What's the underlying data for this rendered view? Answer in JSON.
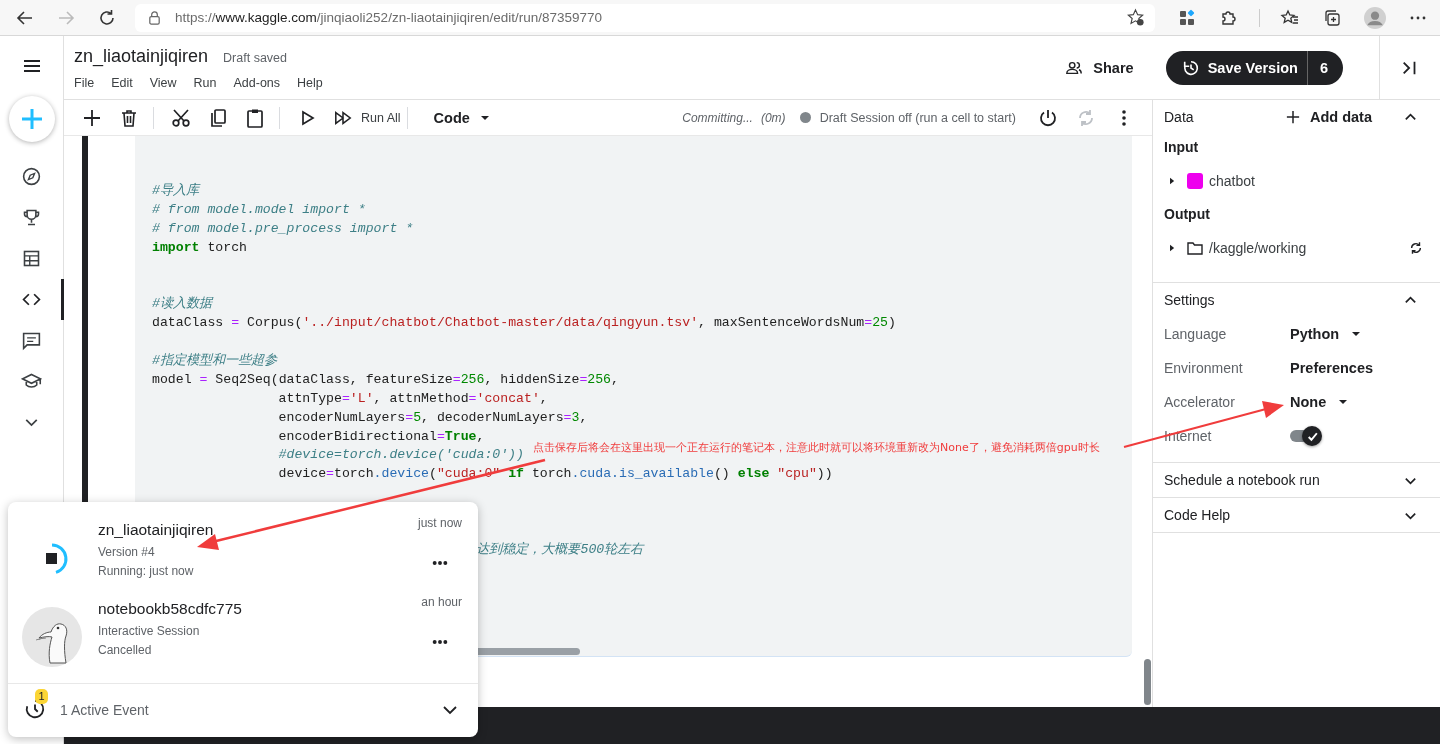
{
  "browser": {
    "url_prefix": "https://",
    "url_host": "www.kaggle.com",
    "url_path": "/jinqiaoli252/zn-liaotainjiqiren/edit/run/87359770",
    "forward_disabled": true
  },
  "rail": {
    "items": [
      {
        "kind": "compass",
        "selected": false
      },
      {
        "kind": "trophy",
        "selected": false
      },
      {
        "kind": "table",
        "selected": false
      },
      {
        "kind": "code",
        "selected": true
      },
      {
        "kind": "comment",
        "selected": false
      },
      {
        "kind": "cap",
        "selected": false
      },
      {
        "kind": "more",
        "selected": false
      }
    ]
  },
  "notebook": {
    "title": "zn_liaotainjiqiren",
    "status": "Draft saved",
    "menu": [
      "File",
      "Edit",
      "View",
      "Run",
      "Add-ons",
      "Help"
    ]
  },
  "header_buttons": {
    "share": "Share",
    "save_version": "Save Version",
    "version_count": "6"
  },
  "toolbar": {
    "run_all": "Run All",
    "cell_type": "Code",
    "commit_status": "Committing...",
    "commit_time": "(0m)",
    "session_status": "Draft Session off (run a cell to start)"
  },
  "code_lines": [
    {
      "kind": "code",
      "tokens": [
        {
          "comment": "#导入库"
        }
      ]
    },
    {
      "kind": "code",
      "tokens": [
        {
          "comment": "# from model.model import *"
        }
      ]
    },
    {
      "kind": "code",
      "tokens": [
        {
          "comment": "# from model.pre_process import *"
        }
      ]
    },
    {
      "kind": "code",
      "tokens": [
        {
          "keyword": "import"
        },
        {
          "text": " torch"
        }
      ]
    },
    {
      "kind": "blank"
    },
    {
      "kind": "blank"
    },
    {
      "kind": "code",
      "tokens": [
        {
          "comment": "#读入数据"
        }
      ]
    },
    {
      "kind": "code",
      "tokens": [
        {
          "text": "dataClass "
        },
        {
          "operator": "="
        },
        {
          "text": " Corpus("
        },
        {
          "string": "'../input/chatbot/Chatbot-master/data/qingyun.tsv'"
        },
        {
          "text": ", maxSentenceWordsNum"
        },
        {
          "operator": "="
        },
        {
          "number": "25"
        },
        {
          "text": ")"
        }
      ]
    },
    {
      "kind": "blank"
    },
    {
      "kind": "code",
      "tokens": [
        {
          "comment": "#指定模型和一些超参"
        }
      ]
    },
    {
      "kind": "code",
      "tokens": [
        {
          "text": "model "
        },
        {
          "operator": "="
        },
        {
          "text": " Seq2Seq(dataClass, featureSize"
        },
        {
          "operator": "="
        },
        {
          "number": "256"
        },
        {
          "text": ", hiddenSize"
        },
        {
          "operator": "="
        },
        {
          "number": "256"
        },
        {
          "text": ","
        }
      ]
    },
    {
      "kind": "code",
      "tokens": [
        {
          "text": "                attnType"
        },
        {
          "operator": "="
        },
        {
          "string": "'L'"
        },
        {
          "text": ", attnMethod"
        },
        {
          "operator": "="
        },
        {
          "string": "'concat'"
        },
        {
          "text": ","
        }
      ]
    },
    {
      "kind": "code",
      "tokens": [
        {
          "text": "                encoderNumLayers"
        },
        {
          "operator": "="
        },
        {
          "number": "5"
        },
        {
          "text": ", decoderNumLayers"
        },
        {
          "operator": "="
        },
        {
          "number": "3"
        },
        {
          "text": ","
        }
      ]
    },
    {
      "kind": "code",
      "tokens": [
        {
          "text": "                encoderBidirectional"
        },
        {
          "operator": "="
        },
        {
          "keyword": "True"
        },
        {
          "text": ","
        }
      ]
    },
    {
      "kind": "code",
      "tokens": [
        {
          "comment": "                #device=torch.device('cuda:0'))"
        }
      ]
    },
    {
      "kind": "code",
      "tokens": [
        {
          "text": "                device"
        },
        {
          "operator": "="
        },
        {
          "text": "torch"
        },
        {
          "attribute": ".device"
        },
        {
          "text": "("
        },
        {
          "string": "\"cuda:0\""
        },
        {
          "keyword": " if"
        },
        {
          "text": " torch"
        },
        {
          "attribute": ".cuda.is_available"
        },
        {
          "text": "() "
        },
        {
          "keyword": "else"
        },
        {
          "string": " \"cpu\""
        },
        {
          "text": "))"
        }
      ]
    },
    {
      "kind": "blank"
    },
    {
      "kind": "blank"
    },
    {
      "kind": "blank"
    },
    {
      "kind": "code",
      "tokens": [
        {
          "comment": "                                         达到稳定，大概要500轮左右"
        }
      ]
    }
  ],
  "data_panel": {
    "title": "Data",
    "add": "Add data",
    "expanded": true,
    "input_label": "Input",
    "inputs": [
      {
        "name": "chatbot",
        "color": "#ee00ee"
      }
    ],
    "output_label": "Output",
    "outputs": [
      {
        "name": "/kaggle/working"
      }
    ]
  },
  "settings": {
    "title": "Settings",
    "expanded": true,
    "rows": [
      {
        "label": "Language",
        "kind": "dropdown",
        "value": "Python"
      },
      {
        "label": "Environment",
        "kind": "text",
        "value": "Preferences"
      },
      {
        "label": "Accelerator",
        "kind": "dropdown",
        "value": "None"
      },
      {
        "label": "Internet",
        "kind": "toggle",
        "on": true
      }
    ]
  },
  "sections": [
    {
      "title": "Schedule a notebook run",
      "expanded": false
    },
    {
      "title": "Code Help",
      "expanded": false
    }
  ],
  "activity": {
    "items": [
      {
        "kind": "running",
        "title": "zn_liaotainjiqiren",
        "subtitle": "Version #4",
        "status": "Running: just now",
        "time": "just now"
      },
      {
        "kind": "session",
        "title": "notebookb58cdfc775",
        "subtitle": "Interactive Session",
        "status": "Cancelled",
        "time": "an hour"
      }
    ],
    "badge": "1",
    "footer": "1 Active Event"
  },
  "annotation": {
    "text": "点击保存后将会在这里出现一个正在运行的笔记本，注意此时就可以将环境重新改为None了，避免消耗两倍gpu时长"
  }
}
